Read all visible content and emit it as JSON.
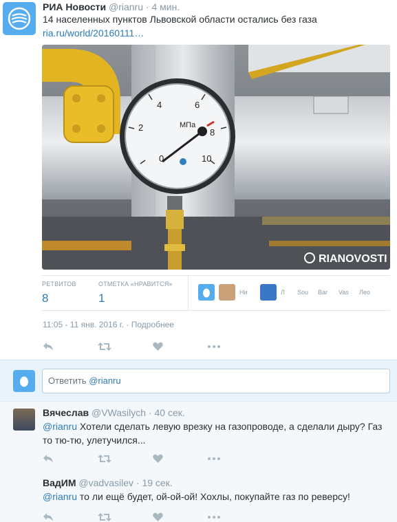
{
  "tweet": {
    "author_name": "РИА Новости",
    "author_handle": "@rianru",
    "separator": "·",
    "time_ago": "4 мин.",
    "text": "14 населенных пунктов Львовской области остались без газа ",
    "link_text": "ria.ru/world/20160111…",
    "photo_watermark": "RIANOVOSTI",
    "gauge_unit": "МПа",
    "gauge_ticks": [
      "0",
      "2",
      "4",
      "6",
      "8",
      "10"
    ],
    "retweets_label": "РЕТВИТОВ",
    "retweets_count": "8",
    "likes_label": "ОТМЕТКА «НРАВИТСЯ»",
    "likes_count": "1",
    "likers": [
      "Ни",
      "Л",
      "Sou",
      "Bar",
      "Vas",
      "Лео"
    ],
    "timestamp": "11:05 - 11 янв. 2016 г.",
    "details_link": "Подробнее",
    "brand_color": "#55acee",
    "link_color": "#2b7bb9"
  },
  "reply_box": {
    "prefix": "Ответить ",
    "handle": "@rianru"
  },
  "replies": [
    {
      "author_name": "Вячеслав",
      "author_handle": "@VWasilych",
      "time_ago": "40 сек.",
      "mention": "@rianru",
      "text": " Хотели сделать левую врезку на газопроводе, а сделали дыру? Газ то тю-тю, улетучился..."
    },
    {
      "author_name": "ВадИМ",
      "author_handle": "@vadvasilev",
      "time_ago": "19 сек.",
      "mention": "@rianru",
      "text": " то ли ещё будет, ой-ой-ой!  Хохлы, покупайте газ по реверсу!"
    }
  ]
}
